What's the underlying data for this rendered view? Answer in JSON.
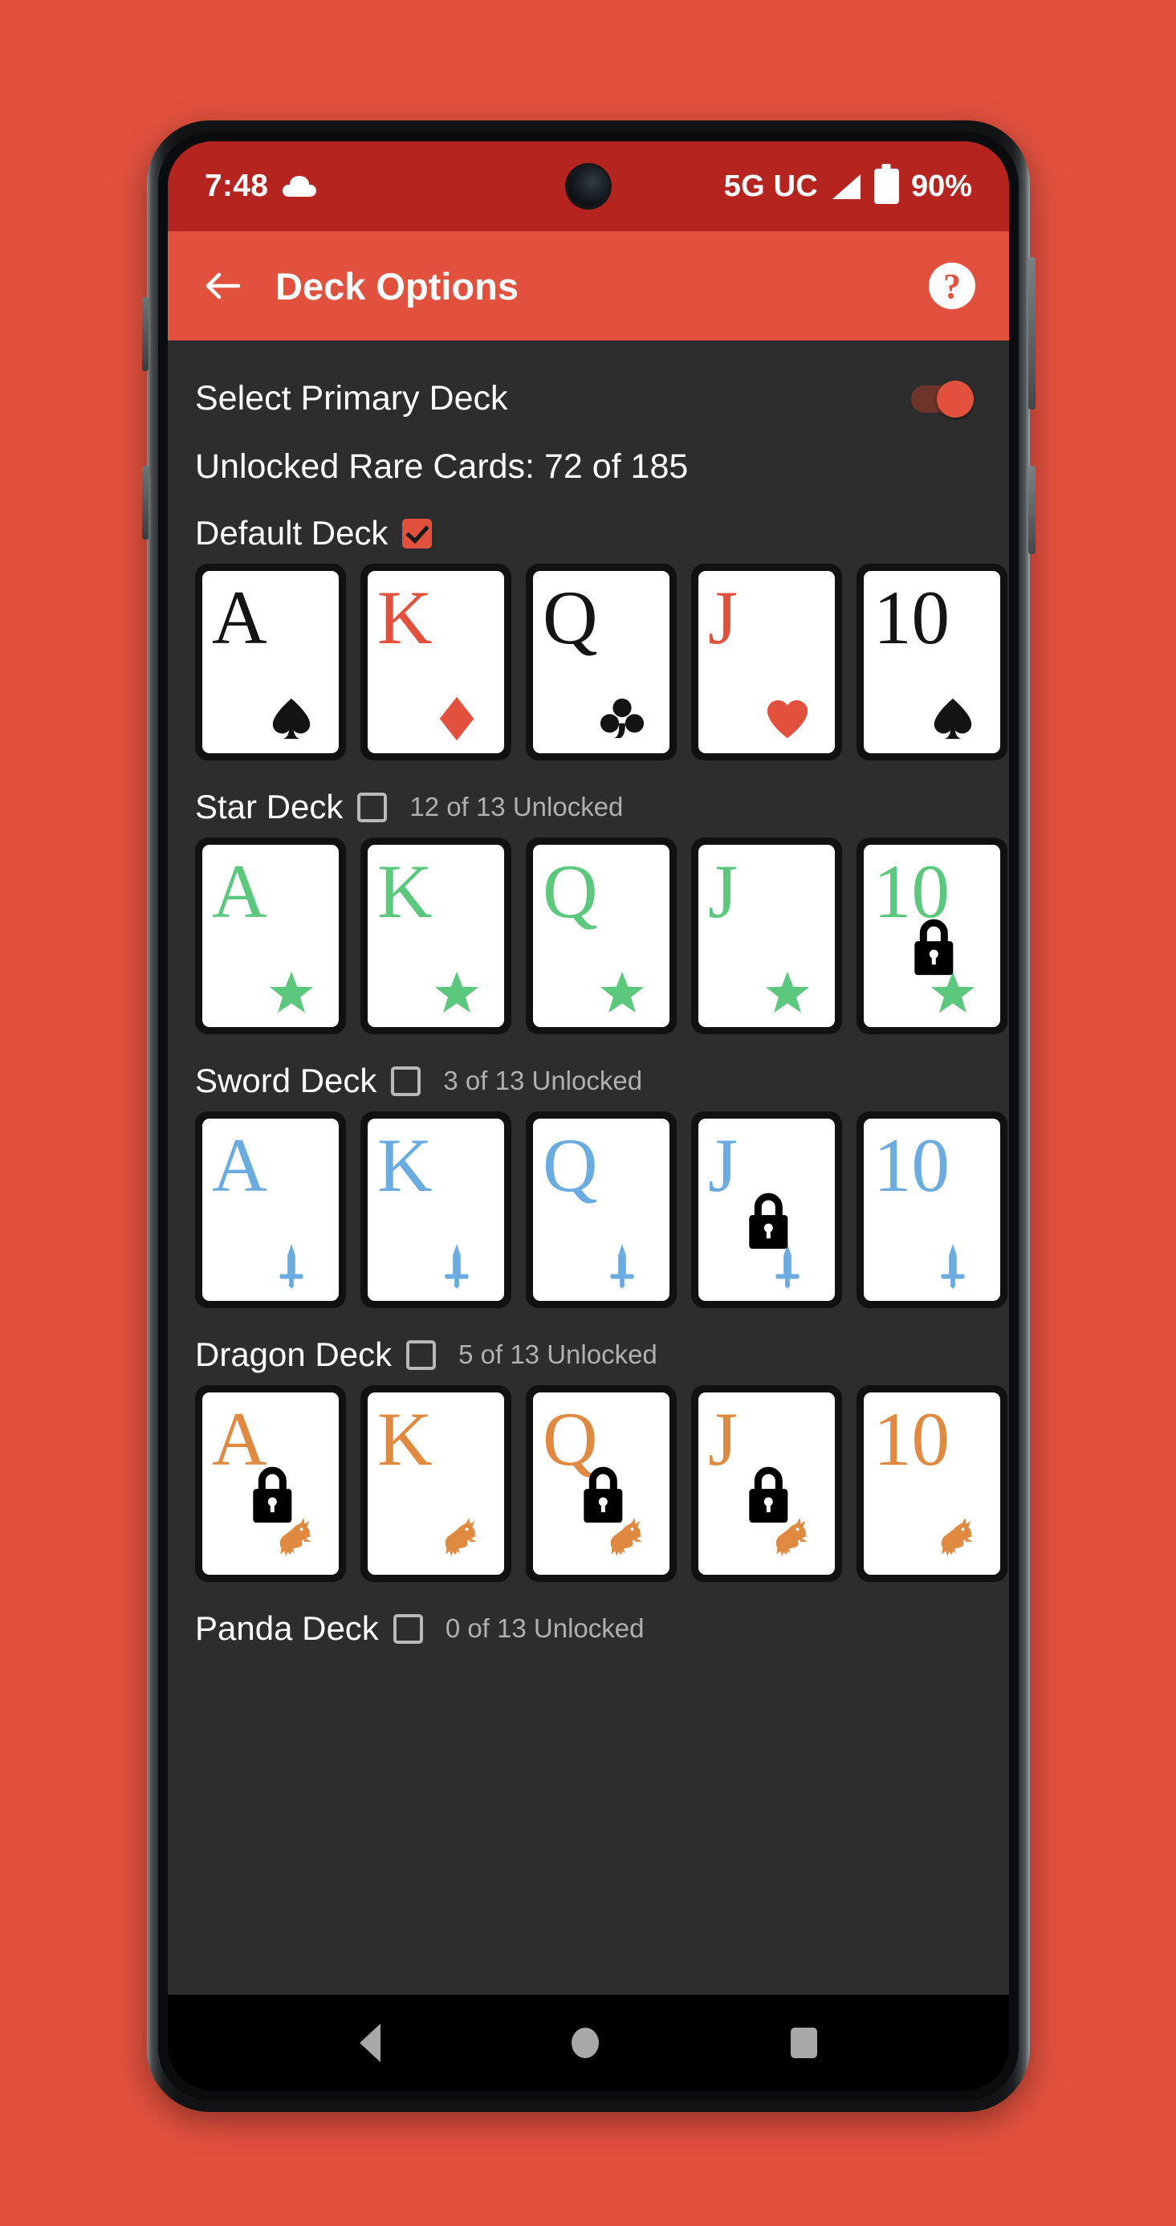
{
  "status_bar": {
    "time": "7:48",
    "weather_icon": "cloud-icon",
    "network": "5G UC",
    "signal_icon": "signal-bars-icon",
    "battery_icon": "battery-icon",
    "battery_percent": "90%"
  },
  "app_bar": {
    "back_icon": "back-arrow-icon",
    "title": "Deck Options",
    "help_label": "?"
  },
  "settings": {
    "primary_deck_label": "Select Primary Deck",
    "primary_deck_toggle": "on",
    "rare_cards_label": "Unlocked Rare Cards: 72 of 185"
  },
  "colors": {
    "accent": "#e2513e",
    "status_bar": "#b5241f",
    "background": "#2d2d2d",
    "star_green": "#5cc87e",
    "sword_blue": "#6aabe0",
    "dragon_orange": "#e08a41",
    "card_black": "#141414",
    "card_red": "#e2513e"
  },
  "decks": [
    {
      "name": "Default Deck",
      "checked": true,
      "unlocked_text": "",
      "cards": [
        {
          "rank": "A",
          "suit": "spade",
          "color": "#141414",
          "locked": false
        },
        {
          "rank": "K",
          "suit": "diamond",
          "color": "#e2513e",
          "locked": false
        },
        {
          "rank": "Q",
          "suit": "club",
          "color": "#141414",
          "locked": false
        },
        {
          "rank": "J",
          "suit": "heart",
          "color": "#e2513e",
          "locked": false
        },
        {
          "rank": "10",
          "suit": "spade",
          "color": "#141414",
          "locked": false
        }
      ]
    },
    {
      "name": "Star Deck",
      "checked": false,
      "unlocked_text": "12 of 13 Unlocked",
      "cards": [
        {
          "rank": "A",
          "suit": "star",
          "color": "#5cc87e",
          "locked": false
        },
        {
          "rank": "K",
          "suit": "star",
          "color": "#5cc87e",
          "locked": false
        },
        {
          "rank": "Q",
          "suit": "star",
          "color": "#5cc87e",
          "locked": false
        },
        {
          "rank": "J",
          "suit": "star",
          "color": "#5cc87e",
          "locked": false
        },
        {
          "rank": "10",
          "suit": "star",
          "color": "#5cc87e",
          "locked": true
        }
      ]
    },
    {
      "name": "Sword Deck",
      "checked": false,
      "unlocked_text": "3 of 13 Unlocked",
      "cards": [
        {
          "rank": "A",
          "suit": "sword",
          "color": "#6aabe0",
          "locked": false
        },
        {
          "rank": "K",
          "suit": "sword",
          "color": "#6aabe0",
          "locked": false
        },
        {
          "rank": "Q",
          "suit": "sword",
          "color": "#6aabe0",
          "locked": false
        },
        {
          "rank": "J",
          "suit": "sword",
          "color": "#6aabe0",
          "locked": true
        },
        {
          "rank": "10",
          "suit": "sword",
          "color": "#6aabe0",
          "locked": false
        }
      ]
    },
    {
      "name": "Dragon Deck",
      "checked": false,
      "unlocked_text": "5 of 13 Unlocked",
      "cards": [
        {
          "rank": "A",
          "suit": "dragon",
          "color": "#e08a41",
          "locked": true
        },
        {
          "rank": "K",
          "suit": "dragon",
          "color": "#e08a41",
          "locked": false
        },
        {
          "rank": "Q",
          "suit": "dragon",
          "color": "#e08a41",
          "locked": true
        },
        {
          "rank": "J",
          "suit": "dragon",
          "color": "#e08a41",
          "locked": true
        },
        {
          "rank": "10",
          "suit": "dragon",
          "color": "#e08a41",
          "locked": false
        }
      ]
    },
    {
      "name": "Panda Deck",
      "checked": false,
      "unlocked_text": "0 of 13 Unlocked",
      "cards": []
    }
  ],
  "nav_bar": {
    "back_icon": "nav-back-icon",
    "home_icon": "nav-home-icon",
    "recents_icon": "nav-recents-icon"
  }
}
